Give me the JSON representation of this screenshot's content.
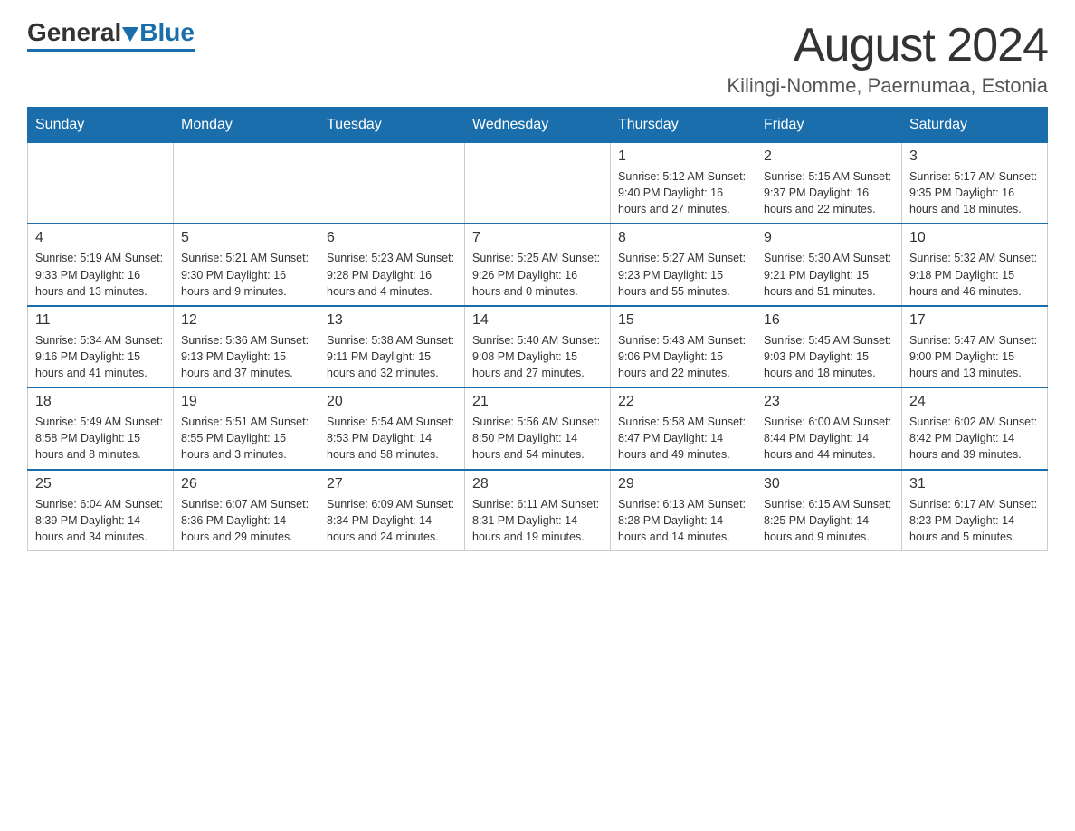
{
  "header": {
    "logo_general": "General",
    "logo_blue": "Blue",
    "month_title": "August 2024",
    "location": "Kilingi-Nomme, Paernumaa, Estonia"
  },
  "days_of_week": [
    "Sunday",
    "Monday",
    "Tuesday",
    "Wednesday",
    "Thursday",
    "Friday",
    "Saturday"
  ],
  "weeks": [
    {
      "days": [
        {
          "num": "",
          "info": ""
        },
        {
          "num": "",
          "info": ""
        },
        {
          "num": "",
          "info": ""
        },
        {
          "num": "",
          "info": ""
        },
        {
          "num": "1",
          "info": "Sunrise: 5:12 AM\nSunset: 9:40 PM\nDaylight: 16 hours\nand 27 minutes."
        },
        {
          "num": "2",
          "info": "Sunrise: 5:15 AM\nSunset: 9:37 PM\nDaylight: 16 hours\nand 22 minutes."
        },
        {
          "num": "3",
          "info": "Sunrise: 5:17 AM\nSunset: 9:35 PM\nDaylight: 16 hours\nand 18 minutes."
        }
      ]
    },
    {
      "days": [
        {
          "num": "4",
          "info": "Sunrise: 5:19 AM\nSunset: 9:33 PM\nDaylight: 16 hours\nand 13 minutes."
        },
        {
          "num": "5",
          "info": "Sunrise: 5:21 AM\nSunset: 9:30 PM\nDaylight: 16 hours\nand 9 minutes."
        },
        {
          "num": "6",
          "info": "Sunrise: 5:23 AM\nSunset: 9:28 PM\nDaylight: 16 hours\nand 4 minutes."
        },
        {
          "num": "7",
          "info": "Sunrise: 5:25 AM\nSunset: 9:26 PM\nDaylight: 16 hours\nand 0 minutes."
        },
        {
          "num": "8",
          "info": "Sunrise: 5:27 AM\nSunset: 9:23 PM\nDaylight: 15 hours\nand 55 minutes."
        },
        {
          "num": "9",
          "info": "Sunrise: 5:30 AM\nSunset: 9:21 PM\nDaylight: 15 hours\nand 51 minutes."
        },
        {
          "num": "10",
          "info": "Sunrise: 5:32 AM\nSunset: 9:18 PM\nDaylight: 15 hours\nand 46 minutes."
        }
      ]
    },
    {
      "days": [
        {
          "num": "11",
          "info": "Sunrise: 5:34 AM\nSunset: 9:16 PM\nDaylight: 15 hours\nand 41 minutes."
        },
        {
          "num": "12",
          "info": "Sunrise: 5:36 AM\nSunset: 9:13 PM\nDaylight: 15 hours\nand 37 minutes."
        },
        {
          "num": "13",
          "info": "Sunrise: 5:38 AM\nSunset: 9:11 PM\nDaylight: 15 hours\nand 32 minutes."
        },
        {
          "num": "14",
          "info": "Sunrise: 5:40 AM\nSunset: 9:08 PM\nDaylight: 15 hours\nand 27 minutes."
        },
        {
          "num": "15",
          "info": "Sunrise: 5:43 AM\nSunset: 9:06 PM\nDaylight: 15 hours\nand 22 minutes."
        },
        {
          "num": "16",
          "info": "Sunrise: 5:45 AM\nSunset: 9:03 PM\nDaylight: 15 hours\nand 18 minutes."
        },
        {
          "num": "17",
          "info": "Sunrise: 5:47 AM\nSunset: 9:00 PM\nDaylight: 15 hours\nand 13 minutes."
        }
      ]
    },
    {
      "days": [
        {
          "num": "18",
          "info": "Sunrise: 5:49 AM\nSunset: 8:58 PM\nDaylight: 15 hours\nand 8 minutes."
        },
        {
          "num": "19",
          "info": "Sunrise: 5:51 AM\nSunset: 8:55 PM\nDaylight: 15 hours\nand 3 minutes."
        },
        {
          "num": "20",
          "info": "Sunrise: 5:54 AM\nSunset: 8:53 PM\nDaylight: 14 hours\nand 58 minutes."
        },
        {
          "num": "21",
          "info": "Sunrise: 5:56 AM\nSunset: 8:50 PM\nDaylight: 14 hours\nand 54 minutes."
        },
        {
          "num": "22",
          "info": "Sunrise: 5:58 AM\nSunset: 8:47 PM\nDaylight: 14 hours\nand 49 minutes."
        },
        {
          "num": "23",
          "info": "Sunrise: 6:00 AM\nSunset: 8:44 PM\nDaylight: 14 hours\nand 44 minutes."
        },
        {
          "num": "24",
          "info": "Sunrise: 6:02 AM\nSunset: 8:42 PM\nDaylight: 14 hours\nand 39 minutes."
        }
      ]
    },
    {
      "days": [
        {
          "num": "25",
          "info": "Sunrise: 6:04 AM\nSunset: 8:39 PM\nDaylight: 14 hours\nand 34 minutes."
        },
        {
          "num": "26",
          "info": "Sunrise: 6:07 AM\nSunset: 8:36 PM\nDaylight: 14 hours\nand 29 minutes."
        },
        {
          "num": "27",
          "info": "Sunrise: 6:09 AM\nSunset: 8:34 PM\nDaylight: 14 hours\nand 24 minutes."
        },
        {
          "num": "28",
          "info": "Sunrise: 6:11 AM\nSunset: 8:31 PM\nDaylight: 14 hours\nand 19 minutes."
        },
        {
          "num": "29",
          "info": "Sunrise: 6:13 AM\nSunset: 8:28 PM\nDaylight: 14 hours\nand 14 minutes."
        },
        {
          "num": "30",
          "info": "Sunrise: 6:15 AM\nSunset: 8:25 PM\nDaylight: 14 hours\nand 9 minutes."
        },
        {
          "num": "31",
          "info": "Sunrise: 6:17 AM\nSunset: 8:23 PM\nDaylight: 14 hours\nand 5 minutes."
        }
      ]
    }
  ]
}
